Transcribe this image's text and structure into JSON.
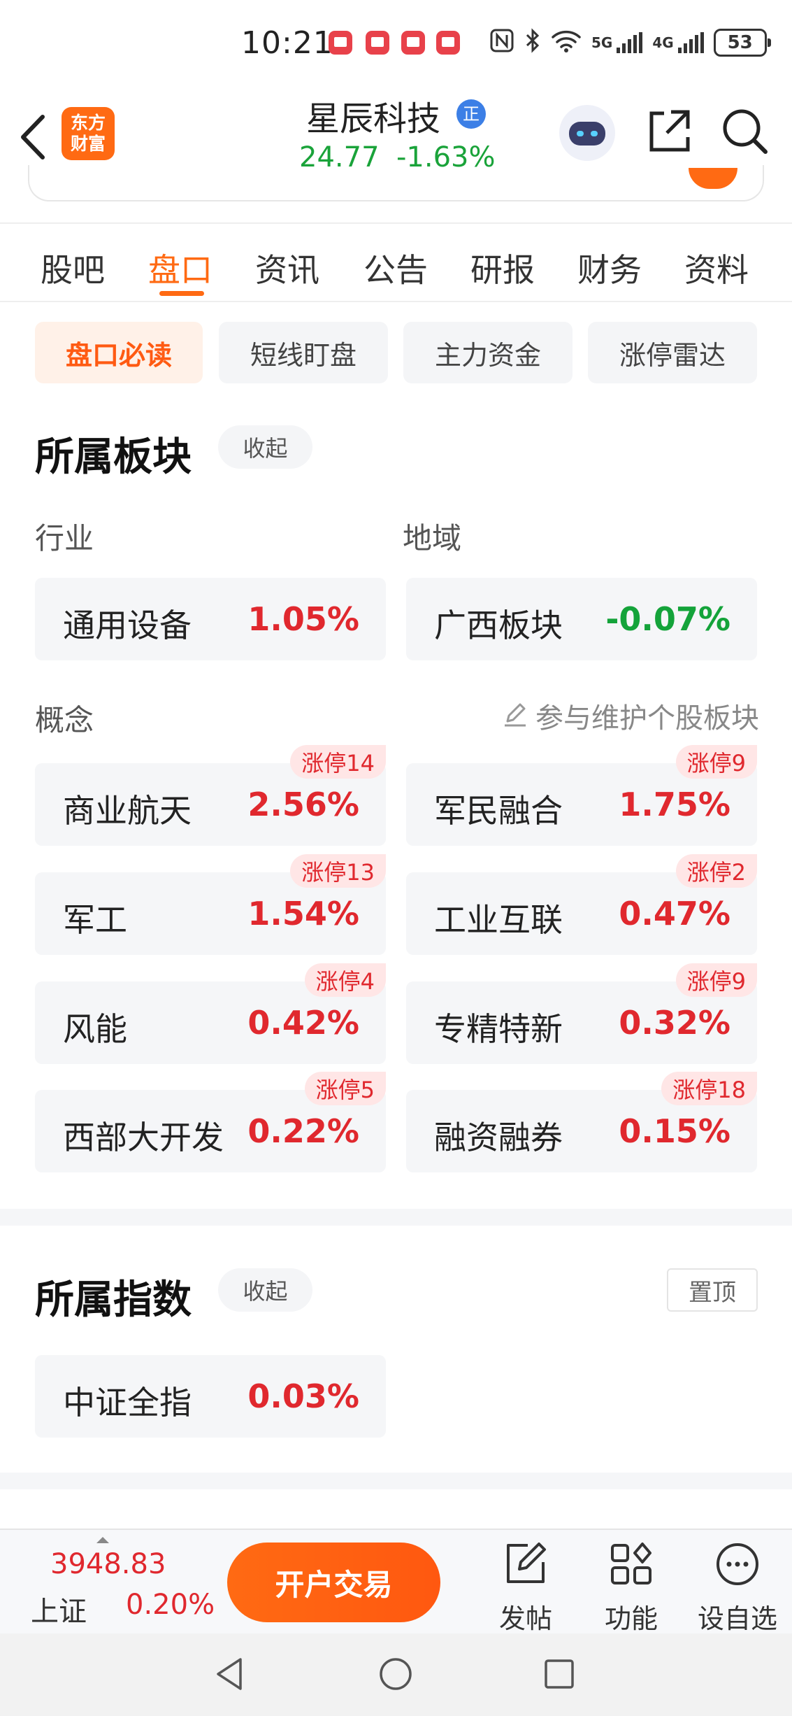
{
  "status_bar": {
    "time": "10:21",
    "battery": "53",
    "net_1": "5G",
    "net_2": "4G"
  },
  "header": {
    "logo_line1": "东方",
    "logo_line2": "财富",
    "stock_name": "星辰科技",
    "badge": "正",
    "price": "24.77",
    "change_pct": "-1.63%"
  },
  "tabs": [
    "股吧",
    "盘口",
    "资讯",
    "公告",
    "研报",
    "财务",
    "资料"
  ],
  "subtabs": [
    "盘口必读",
    "短线盯盘",
    "主力资金",
    "涨停雷达"
  ],
  "sectors": {
    "title": "所属板块",
    "collapse_label": "收起",
    "industry_label": "行业",
    "region_label": "地域",
    "industry": {
      "name": "通用设备",
      "pct": "1.05%"
    },
    "region": {
      "name": "广西板块",
      "pct": "-0.07%"
    },
    "concept_label": "概念",
    "maintain_label": "参与维护个股板块",
    "concepts": [
      {
        "name": "商业航天",
        "pct": "2.56%",
        "tag": "涨停14"
      },
      {
        "name": "军民融合",
        "pct": "1.75%",
        "tag": "涨停9"
      },
      {
        "name": "军工",
        "pct": "1.54%",
        "tag": "涨停13"
      },
      {
        "name": "工业互联",
        "pct": "0.47%",
        "tag": "涨停2"
      },
      {
        "name": "风能",
        "pct": "0.42%",
        "tag": "涨停4"
      },
      {
        "name": "专精特新",
        "pct": "0.32%",
        "tag": "涨停9"
      },
      {
        "name": "西部大开发",
        "pct": "0.22%",
        "tag": "涨停5"
      },
      {
        "name": "融资融券",
        "pct": "0.15%",
        "tag": "涨停18"
      }
    ]
  },
  "indices": {
    "title": "所属指数",
    "collapse_label": "收起",
    "pin_label": "置顶",
    "items": [
      {
        "name": "中证全指",
        "pct": "0.03%"
      }
    ]
  },
  "bottom_bar": {
    "index_value": "3948.83",
    "index_name": "上证",
    "index_pct": "0.20%",
    "open_account": "开户交易",
    "post_label": "发帖",
    "features_label": "功能",
    "watchlist_label": "设自选"
  },
  "colors": {
    "accent": "#ff6a13",
    "up": "#e0282e",
    "down": "#14a33a"
  }
}
